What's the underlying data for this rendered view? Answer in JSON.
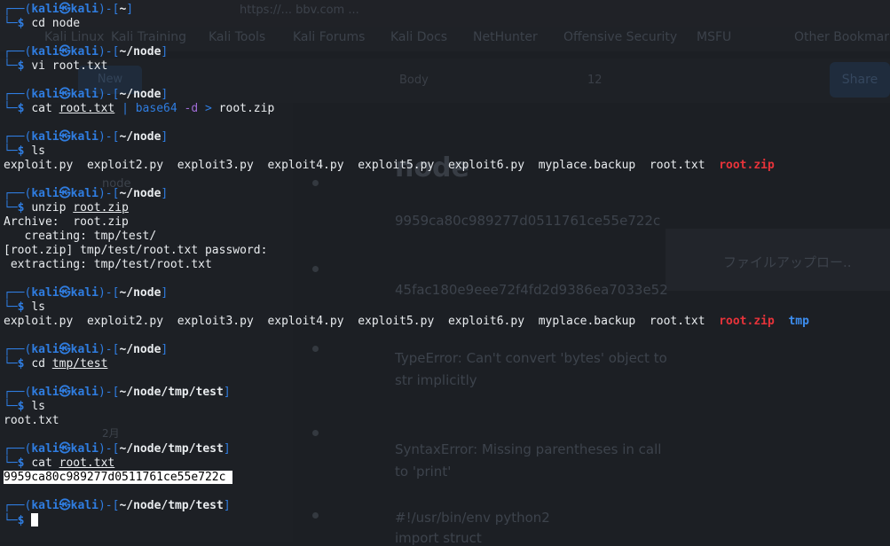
{
  "background": {
    "url": "https://... bbv.com ...",
    "bookmarks": [
      "Kali Linux",
      "Kali Training",
      "Kali Tools",
      "Kali Forums",
      "Kali Docs",
      "NetHunter",
      "Offensive Security",
      "MSFU",
      "Other Bookmarks"
    ],
    "toolbar": {
      "new_label": "New",
      "style": "Body",
      "size": "12",
      "share_label": "Share"
    },
    "doc": {
      "title": "node",
      "lines": [
        "9959ca80c989277d0511761ce55e722c",
        "45fac180e9eee72f4fd2d9386ea7033e52",
        "TypeError: Can't convert 'bytes' object to",
        "str implicitly",
        "SyntaxError: Missing parentheses in call",
        "to 'print'",
        "#!/usr/bin/env python2",
        "import struct"
      ],
      "bullet": "ファイルアップロー..",
      "side_items": [
        "node",
        "新規",
        "2月"
      ]
    }
  },
  "terminal": {
    "user": "kali",
    "host": "kali",
    "prompt_frame_top": "┌──",
    "prompt_frame_bottom": "└─",
    "prompt_symbol": "$",
    "blocks": [
      {
        "cwd": "~",
        "cmd": "cd node"
      },
      {
        "cwd": "~/node",
        "cmd": "vi root.txt"
      },
      {
        "cwd": "~/node",
        "cmd_parts": [
          "cat",
          "root.txt",
          "|",
          "base64",
          "-d",
          ">",
          "root.zip"
        ]
      },
      {
        "cwd": "~/node",
        "cmd": "ls",
        "ls": [
          "exploit.py",
          "exploit2.py",
          "exploit3.py",
          "exploit4.py",
          "exploit5.py",
          "exploit6.py",
          "myplace.backup",
          "root.txt",
          "root.zip"
        ]
      },
      {
        "cwd": "~/node",
        "cmd_parts": [
          "unzip",
          "root.zip"
        ],
        "output": [
          "Archive:  root.zip",
          "   creating: tmp/test/",
          "[root.zip] tmp/test/root.txt password:",
          " extracting: tmp/test/root.txt"
        ]
      },
      {
        "cwd": "~/node",
        "cmd": "ls",
        "ls": [
          "exploit.py",
          "exploit2.py",
          "exploit3.py",
          "exploit4.py",
          "exploit5.py",
          "exploit6.py",
          "myplace.backup",
          "root.txt",
          "root.zip",
          "tmp"
        ]
      },
      {
        "cwd": "~/node",
        "cmd_parts": [
          "cd",
          "tmp/test"
        ]
      },
      {
        "cwd": "~/node/tmp/test",
        "cmd": "ls",
        "output": [
          "root.txt"
        ]
      },
      {
        "cwd": "~/node/tmp/test",
        "cmd_parts": [
          "cat",
          "root.txt"
        ],
        "highlight": "9959ca80c989277d0511761ce55e722c"
      },
      {
        "cwd": "~/node/tmp/test",
        "cmd": ""
      }
    ]
  },
  "colors": {
    "prompt_blue": "#2f7de1",
    "archive_red": "#e8333a",
    "dir_blue": "#3d8ef0",
    "text": "#e9ecef",
    "flag_purple": "#a06cd5"
  }
}
